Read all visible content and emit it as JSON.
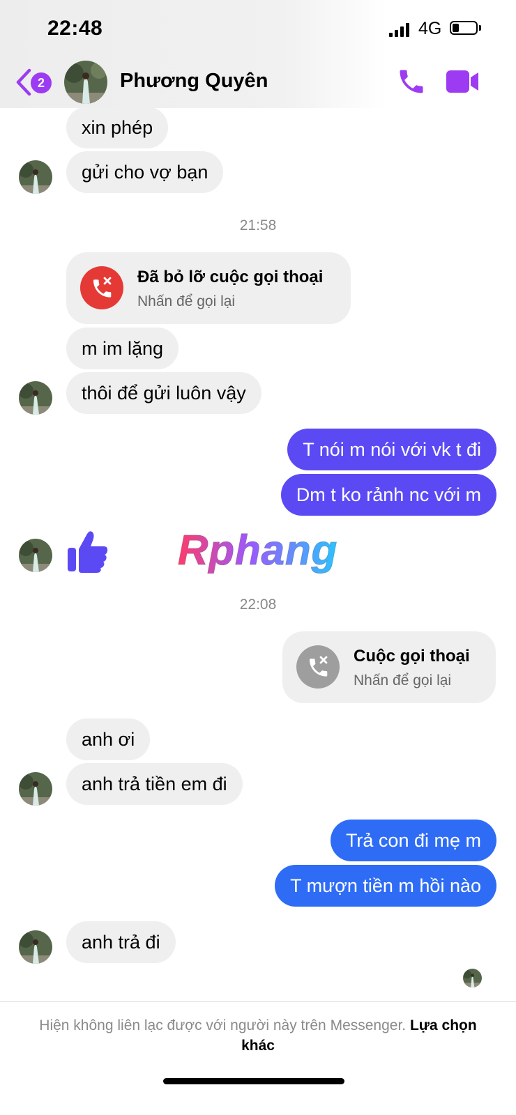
{
  "status_bar": {
    "time": "22:48",
    "network": "4G"
  },
  "header": {
    "back_badge": "2",
    "contact_name": "Phương Quyên"
  },
  "messages": {
    "in1": "xin phép",
    "in2": "gửi cho vợ bạn",
    "ts1": "21:58",
    "missed_call_title": "Đã bỏ lỡ cuộc gọi thoại",
    "missed_call_sub": "Nhấn để gọi lại",
    "in3": "m im lặng",
    "in4": "thôi để gửi luôn vậy",
    "out1": "T nói m nói với vk t đi",
    "out2": "Dm t ko rảnh nc với m",
    "ts2": "22:08",
    "outgoing_call_title": "Cuộc gọi thoại",
    "outgoing_call_sub": "Nhấn để gọi lại",
    "in5": "anh ơi",
    "in6": "anh trả tiền em đi",
    "out3": "Trả con đi mẹ m",
    "out4": "T mượn tiền m hồi nào",
    "in7": "anh trả đi"
  },
  "watermark": "Rphang",
  "footer": {
    "notice": "Hiện không liên lạc được với người này trên Messenger.",
    "link": "Lựa chọn khác"
  },
  "colors": {
    "accent_purple": "#9c3bf2",
    "bubble_out_purple": "#5b4af4",
    "bubble_out_blue": "#2e6cf6",
    "missed_call_red": "#e53935",
    "bubble_in": "#efefef"
  }
}
